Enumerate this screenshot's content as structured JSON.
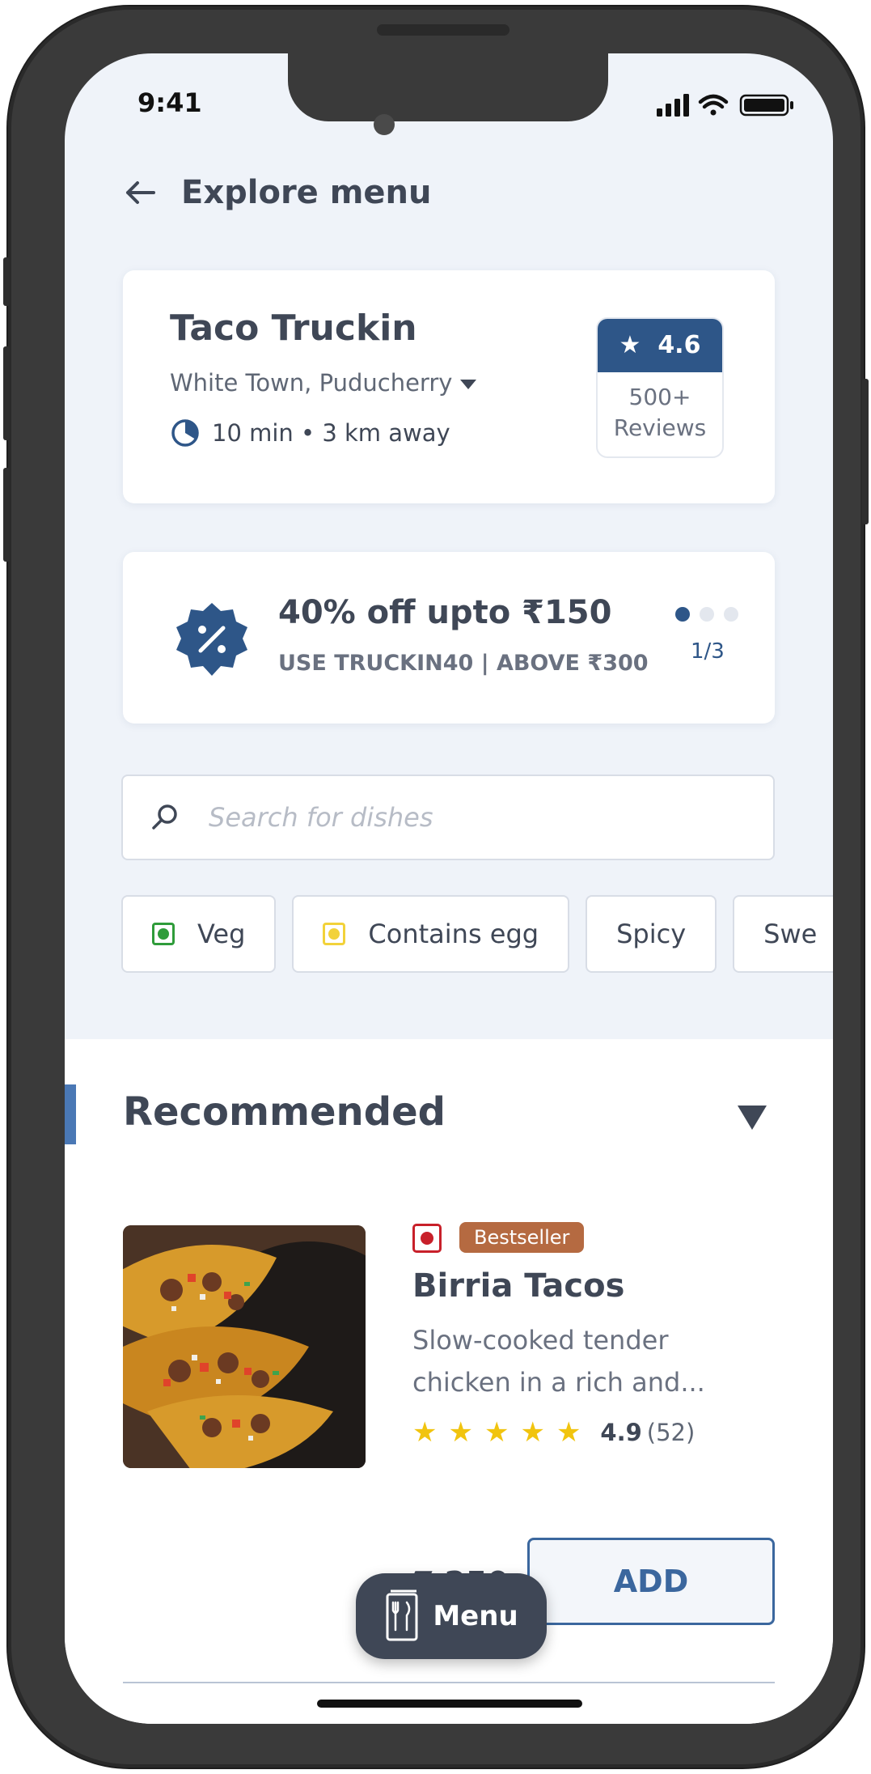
{
  "status_bar": {
    "time": "9:41"
  },
  "header": {
    "title": "Explore menu"
  },
  "restaurant": {
    "name": "Taco Truckin",
    "location": "White Town, Puducherry",
    "eta": "10 min • 3 km away",
    "rating": "4.6",
    "reviews_count": "500+",
    "reviews_label": "Reviews"
  },
  "offer": {
    "title": "40% off upto ₹150",
    "subtitle": "USE TRUCKIN40 | ABOVE ₹300",
    "pager": "1/3"
  },
  "search": {
    "placeholder": "Search for dishes"
  },
  "filters": [
    {
      "label": "Veg"
    },
    {
      "label": "Contains egg"
    },
    {
      "label": "Spicy"
    },
    {
      "label": "Swe"
    }
  ],
  "section": {
    "title": "Recommended"
  },
  "dish": {
    "badge": "Bestseller",
    "name": "Birria Tacos",
    "description": "Slow-cooked tender chicken in a rich and...",
    "rating": "4.9",
    "rating_count": "(52)",
    "stars": 5,
    "price": "₹ 250",
    "add_label": "ADD"
  },
  "menu_button": {
    "label": "Menu"
  },
  "colors": {
    "primary": "#2e5688",
    "text_dark": "#3f4756",
    "background": "#eff3f9",
    "veg": "#2f9c3a",
    "nonveg": "#c8202a",
    "egg": "#f2d23a",
    "bestseller": "#b56a41",
    "star": "#f1c40f"
  }
}
